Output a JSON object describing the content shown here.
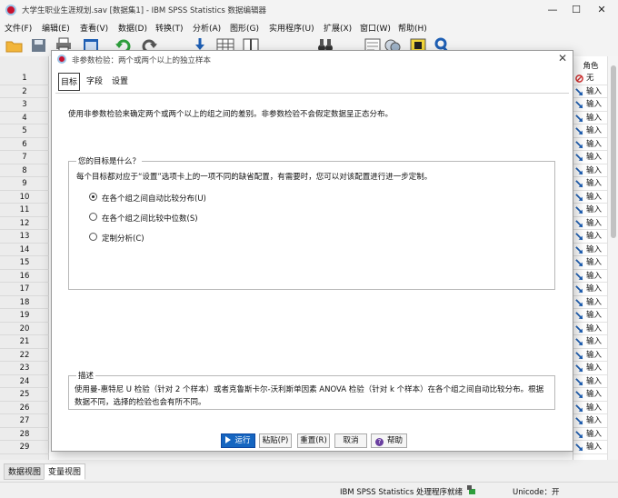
{
  "window": {
    "title": "大学生职业生涯规划.sav [数据集1] - IBM SPSS Statistics 数据编辑器",
    "minimize": "—",
    "maximize": "☐",
    "close": "✕"
  },
  "menu": [
    "文件(F)",
    "编辑(E)",
    "查看(V)",
    "数据(D)",
    "转换(T)",
    "分析(A)",
    "图形(G)",
    "实用程序(U)",
    "扩展(X)",
    "窗口(W)",
    "帮助(H)"
  ],
  "grid": {
    "rows": [
      "1",
      "2",
      "3",
      "4",
      "5",
      "6",
      "7",
      "8",
      "9",
      "10",
      "11",
      "12",
      "13",
      "14",
      "15",
      "16",
      "17",
      "18",
      "19",
      "20",
      "21",
      "22",
      "23",
      "24",
      "25",
      "26",
      "27",
      "28",
      "29"
    ],
    "role_header": "角色",
    "roles": [
      "无",
      "输入",
      "输入",
      "输入",
      "输入",
      "输入",
      "输入",
      "输入",
      "输入",
      "输入",
      "输入",
      "输入",
      "输入",
      "输入",
      "输入",
      "输入",
      "输入",
      "输入",
      "输入",
      "输入",
      "输入",
      "输入",
      "输入",
      "输入",
      "输入",
      "输入",
      "输入",
      "输入",
      "输入"
    ]
  },
  "view_tabs": {
    "data_view": "数据视图",
    "variable_view": "变量视图"
  },
  "status": {
    "processor": "IBM SPSS Statistics 处理程序就绪",
    "unicode": "Unicode：开"
  },
  "dialog": {
    "title": "非参数检验：两个或两个以上的独立样本",
    "close": "✕",
    "tabs": [
      "目标",
      "字段",
      "设置"
    ],
    "intro": "使用非参数检验来确定两个或两个以上的组之间的差别。非参数检验不会假定数据呈正态分布。",
    "goal_legend": "您的目标是什么？",
    "goal_desc": "每个目标都对应于“设置”选项卡上的一项不同的缺省配置，有需要时，您可以对该配置进行进一步定制。",
    "options": [
      {
        "label": "在各个组之间自动比较分布(U)",
        "selected": true
      },
      {
        "label": "在各个组之间比较中位数(S)",
        "selected": false
      },
      {
        "label": "定制分析(C)",
        "selected": false
      }
    ],
    "desc_legend": "描述",
    "desc_line1": "使用曼-惠特尼 U 检验（针对 2 个样本）或者克鲁斯卡尔-沃利斯单因素 ANOVA 检验（针对 k 个样本）在各个组之间自动比较分布。根据",
    "desc_line2": "数据不同，选择的检验也会有所不同。",
    "buttons": {
      "run": "运行",
      "paste": "粘贴(P)",
      "reset": "重置(R)",
      "cancel": "取消",
      "help": "帮助"
    }
  },
  "colors": {
    "primary_button": "#1565c0",
    "role_icon": "#1e5fb4",
    "none_icon": "#d32f2f"
  }
}
